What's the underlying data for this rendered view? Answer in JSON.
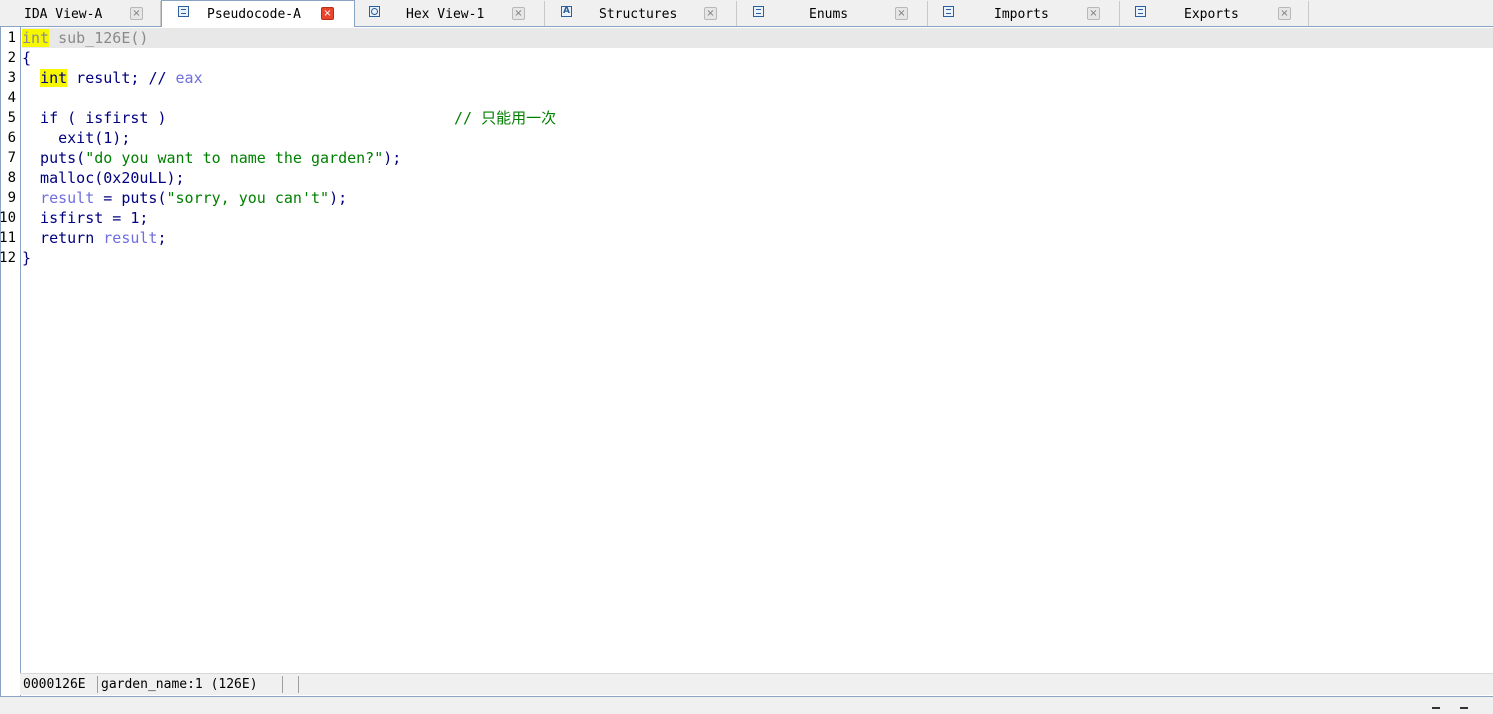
{
  "tabs": [
    {
      "label": "IDA View-A",
      "icon": "graph-view-icon",
      "active": false
    },
    {
      "label": "Pseudocode-A",
      "icon": "pseudocode-icon",
      "active": true
    },
    {
      "label": "Hex View-1",
      "icon": "hex-view-icon",
      "active": false
    },
    {
      "label": "Structures",
      "icon": "structures-icon",
      "active": false
    },
    {
      "label": "Enums",
      "icon": "enums-icon",
      "active": false
    },
    {
      "label": "Imports",
      "icon": "imports-icon",
      "active": false
    },
    {
      "label": "Exports",
      "icon": "exports-icon",
      "active": false
    }
  ],
  "close_glyph": "×",
  "line_numbers": [
    "1",
    "2",
    "3",
    "4",
    "5",
    "6",
    "7",
    "8",
    "9",
    "10",
    "11",
    "12"
  ],
  "code": {
    "l1_type": "int",
    "l1_rest": " sub_126E()",
    "l2": "{",
    "l3_type": "int",
    "l3_rest": " result; ",
    "l3_cmt_slash": "//",
    "l3_cmt_reg": " eax",
    "l5_code": "  if ( isfirst )",
    "l5_comment": "// 只能用一次",
    "l6": "    exit(1);",
    "l7_call": "  puts(",
    "l7_str": "\"do you want to name the garden?\"",
    "l7_end": ");",
    "l8": "  malloc(0x20uLL);",
    "l9_var": "result",
    "l9_mid": " = puts(",
    "l9_str": "\"sorry, you can't\"",
    "l9_end": ");",
    "l10": "  isfirst = 1;",
    "l11_kw": "  return ",
    "l11_var": "result",
    "l11_end": ";",
    "l12": "}"
  },
  "status": {
    "address": "0000126E",
    "location": "garden_name:1 (126E)"
  },
  "colors": {
    "keyword_highlight": "#f7f700",
    "identifier": "#000080",
    "local_var": "#6e6ee0",
    "string": "#008000",
    "comment": "#008000",
    "active_close": "#e8452c"
  }
}
